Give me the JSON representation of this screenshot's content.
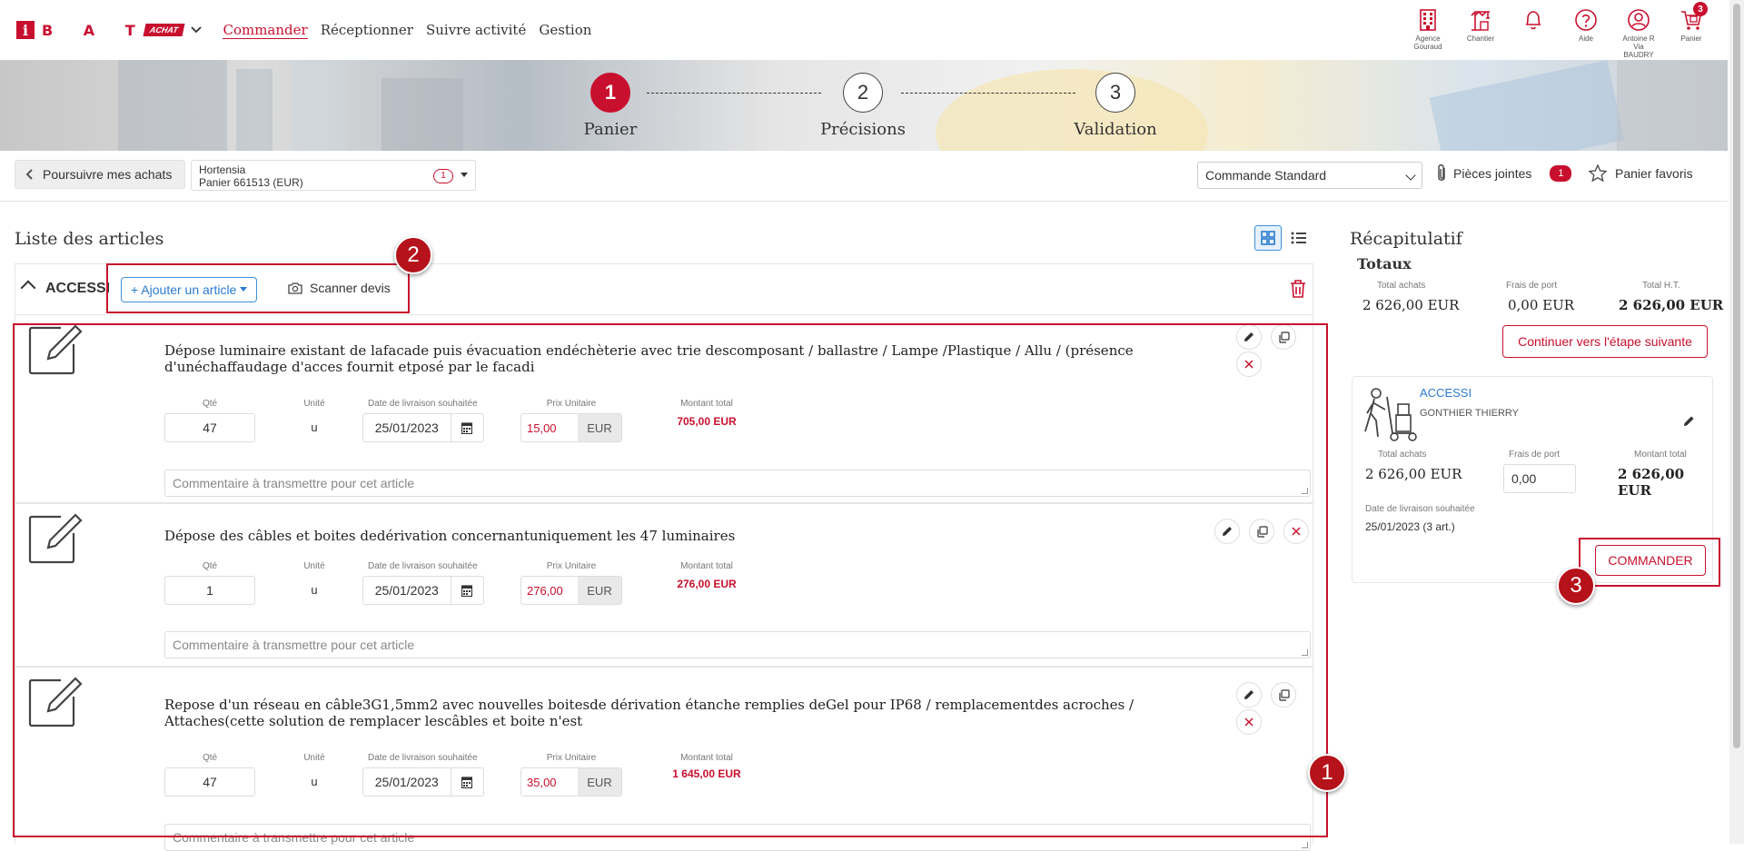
{
  "brand": {
    "letters": "B A T",
    "i": "i",
    "tag": "ACHAT"
  },
  "nav": [
    {
      "label": "Commander",
      "active": true
    },
    {
      "label": "Réceptionner"
    },
    {
      "label": "Suivre activité"
    },
    {
      "label": "Gestion"
    }
  ],
  "top_icons": [
    {
      "name": "agence-icon",
      "label": "Agence Gouraud"
    },
    {
      "name": "chantier-icon",
      "label": "Chantier"
    },
    {
      "name": "bell-icon",
      "label": ""
    },
    {
      "name": "help-icon",
      "label": "Aide"
    },
    {
      "name": "user-icon",
      "label": "Antoine R Via BAUDRY"
    },
    {
      "name": "cart-icon",
      "label": "Panier",
      "badge": "3"
    }
  ],
  "steps": [
    {
      "num": "1",
      "label": "Panier",
      "active": true
    },
    {
      "num": "2",
      "label": "Précisions"
    },
    {
      "num": "3",
      "label": "Validation"
    }
  ],
  "toolbar": {
    "back_label": "Poursuivre mes achats",
    "cart_name": "Hortensia",
    "cart_sub": "Panier 661513 (EUR)",
    "cart_count": "1",
    "order_type": "Commande Standard",
    "attachments_label": "Pièces jointes",
    "attachments_count": "1",
    "favorites_label": "Panier favoris"
  },
  "list": {
    "title": "Liste des articles",
    "group_name": "ACCESSI",
    "add_label": "+ Ajouter un article",
    "scan_label": "Scanner devis",
    "labels": {
      "qty": "Qté",
      "unit": "Unité",
      "date": "Date de livraison souhaitée",
      "price": "Prix Unitaire",
      "total": "Montant total"
    },
    "comment_placeholder": "Commentaire à transmettre pour cet article",
    "articles": [
      {
        "desc": "Dépose luminaire existant de lafacade puis évacuation endéchèterie avec trie descomposant / ballastre / Lampe /Plastique / Allu / (présence d'unéchaffaudage d'acces fournit etposé par le facadi",
        "qty": "47",
        "unit": "u",
        "date": "25/01/2023",
        "price": "15,00",
        "currency": "EUR",
        "total": "705,00 EUR"
      },
      {
        "desc": "Dépose des câbles et boites dedérivation concernantuniquement les 47 luminaires",
        "qty": "1",
        "unit": "u",
        "date": "25/01/2023",
        "price": "276,00",
        "currency": "EUR",
        "total": "276,00 EUR"
      },
      {
        "desc": "Repose d'un réseau en câble3G1,5mm2 avec nouvelles boitesde dérivation étanche remplies deGel pour IP68 / remplacementdes acroches / Attaches(cette solution de remplacer lescâbles et boite n'est",
        "qty": "47",
        "unit": "u",
        "date": "25/01/2023",
        "price": "35,00",
        "currency": "EUR",
        "total": "1 645,00 EUR"
      }
    ]
  },
  "recap": {
    "title": "Récapitulatif",
    "totaux_label": "Totaux",
    "total_achats_label": "Total achats",
    "total_achats": "2 626,00 EUR",
    "frais_port_label": "Frais de port",
    "frais_port": "0,00 EUR",
    "total_ht_label": "Total H.T.",
    "total_ht": "2 626,00 EUR",
    "next_label": "Continuer vers l'étape suivante",
    "supplier": {
      "name": "ACCESSI",
      "contact": "GONTHIER THIERRY",
      "total_achats_label": "Total achats",
      "total_achats": "2 626,00 EUR",
      "frais_port_label": "Frais de port",
      "frais_port": "0,00",
      "montant_label": "Montant total",
      "montant": "2 626,00 EUR",
      "date_label": "Date de livraison souhaitée",
      "date": "25/01/2023 (3 art.)",
      "order_label": "COMMANDER"
    }
  },
  "annotations": [
    "1",
    "2",
    "3"
  ],
  "colors": {
    "accent": "#c8102e",
    "link": "#2a7bd0"
  }
}
